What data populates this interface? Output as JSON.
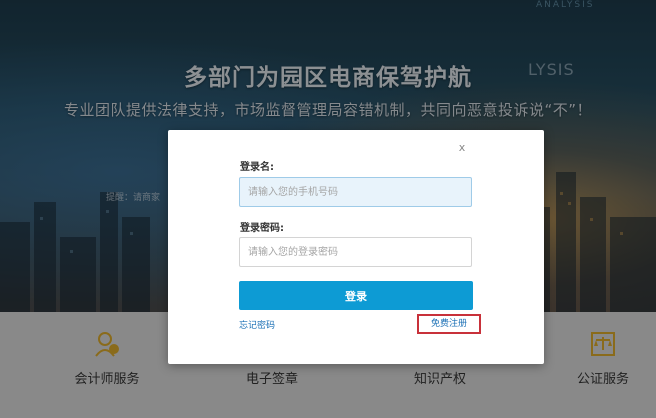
{
  "banner": {
    "top_tag": "ANALYSIS",
    "title": "多部门为园区电商保驾护航",
    "title_deco": "LYSIS",
    "subtitle": "专业团队提供法律支持，市场监督管理局容错机制，共同向恶意投诉说“不”！",
    "hint": "提醒：请商家"
  },
  "login_dialog": {
    "close_label": "x",
    "username_label": "登录名:",
    "username_placeholder": "请输入您的手机号码",
    "password_label": "登录密码:",
    "password_placeholder": "请输入您的登录密码",
    "login_button": "登录",
    "forgot_password": "忘记密码",
    "register": "免费注册"
  },
  "services": [
    {
      "label": "会计师服务",
      "icon": "accountant-icon"
    },
    {
      "label": "电子签章",
      "icon": "e-signature-icon"
    },
    {
      "label": "知识产权",
      "icon": "intellectual-property-icon"
    },
    {
      "label": "公证服务",
      "icon": "notary-scale-icon"
    }
  ],
  "colors": {
    "login_button": "#0d9bd4",
    "link": "#1a6fb5",
    "register_highlight": "#c8313a",
    "service_bar_bg": "#d3d3d3"
  }
}
